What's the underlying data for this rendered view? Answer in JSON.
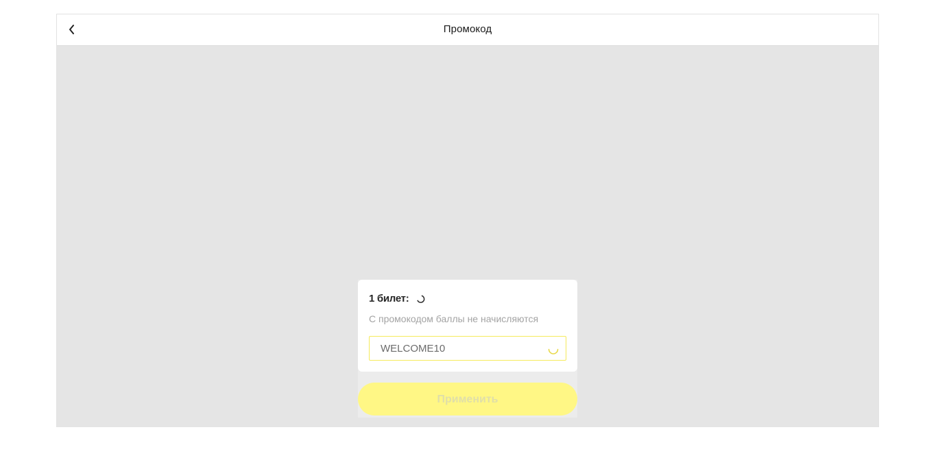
{
  "header": {
    "title": "Промокод",
    "back_icon": "chevron-left-icon"
  },
  "promo": {
    "ticket_label": "1 билет:",
    "ticket_status_icon": "loading-spinner-icon",
    "note": "С промокодом баллы не начисляются",
    "code_value": "WELCOME10",
    "field_status_icon": "loading-spinner-icon",
    "apply_label": "Применить"
  },
  "colors": {
    "accent_yellow": "#fff785",
    "field_border": "#f5ea5a",
    "spinner_yellow": "#e8d94a",
    "background": "#e5e5e5"
  }
}
